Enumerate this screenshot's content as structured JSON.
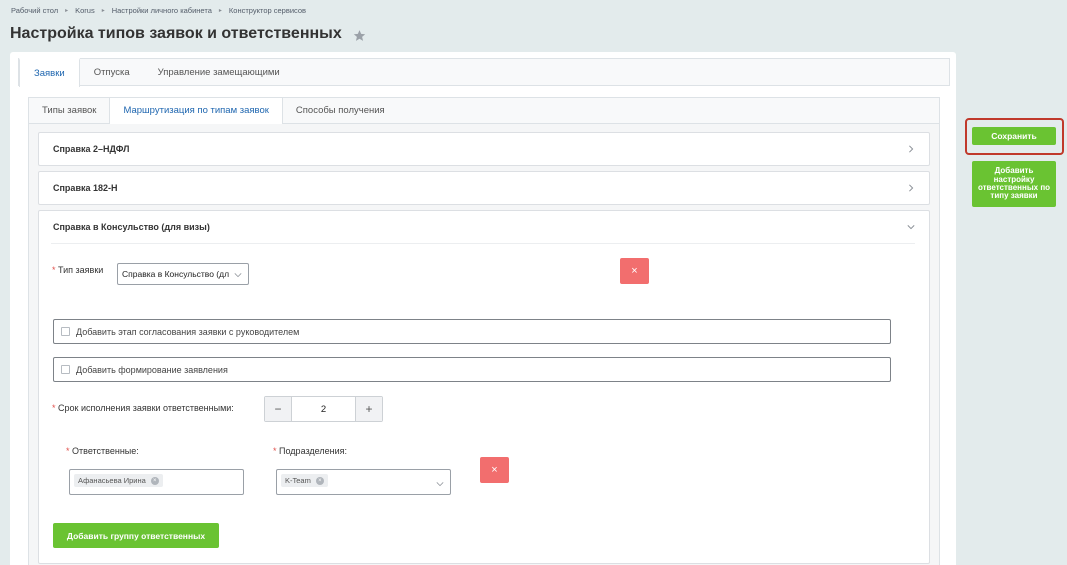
{
  "breadcrumb": [
    "Рабочий стол",
    "Korus",
    "Настройки личного кабинета",
    "Конструктор сервисов"
  ],
  "page": {
    "title": "Настройка типов заявок и ответственных"
  },
  "top_tabs": [
    "Заявки",
    "Отпуска",
    "Управление замещающими"
  ],
  "sub_tabs": [
    "Типы заявок",
    "Маршрутизация по типам заявок",
    "Способы получения"
  ],
  "accordions": [
    {
      "title": "Справка 2–НДФЛ"
    },
    {
      "title": "Справка 182-Н"
    },
    {
      "title": "Справка в Консульство (для визы)"
    }
  ],
  "form": {
    "type_label": "Тип заявки",
    "type_value": "Справка в Консульство (дл",
    "chk_manager": "Добавить этап согласования заявки с руководителем",
    "chk_statement": "Добавить формирование заявления",
    "deadline_label": "Срок исполнения заявки ответственными:",
    "deadline_value": "2",
    "responsible_label": "Ответственные:",
    "responsible_tag": "Афанасьева Ирина",
    "departments_label": "Подразделения:",
    "departments_tag": "K-Team",
    "add_group": "Добавить группу ответственных",
    "required_mark": "*",
    "delete_glyph": "×",
    "minus": "−",
    "plus": "+"
  },
  "actions": {
    "save": "Сохранить",
    "add_setting": "Добавить настройку ответственных по типу заявки"
  },
  "colors": {
    "accent_green": "#6ac332",
    "danger": "#f26e6e",
    "link_blue": "#2067b0",
    "highlight_border": "#c0392b"
  }
}
